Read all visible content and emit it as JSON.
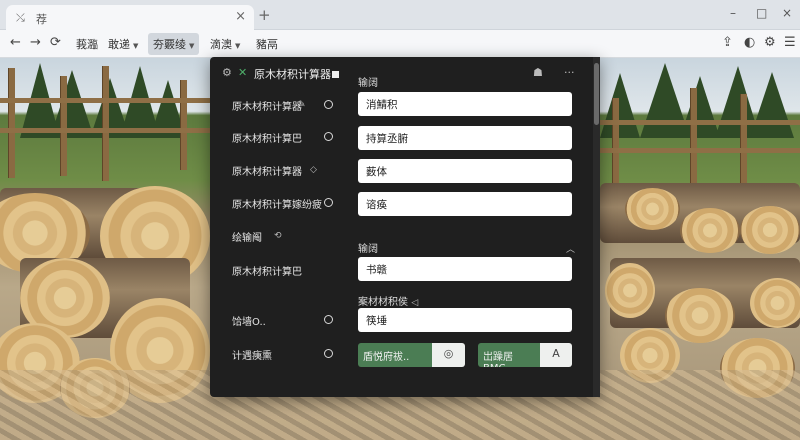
{
  "browser": {
    "tab_title": "荐",
    "tab_close": "×",
    "new_tab": "+",
    "window_controls": [
      "–",
      "□",
      "×"
    ],
    "nav": [
      "←",
      "→"
    ],
    "menus": [
      {
        "label": "莪瀶",
        "caret": false
      },
      {
        "label": "敢递",
        "caret": true
      },
      {
        "label": "夯覈绫",
        "caret": true,
        "active": true
      },
      {
        "label": "滴澳",
        "caret": true
      },
      {
        "label": "豬鬲",
        "caret": false
      }
    ],
    "right_icons": [
      "upload-icon",
      "half-circle-icon",
      "gear-icon",
      "menu-icon"
    ]
  },
  "panel": {
    "title": "原木材积计算器",
    "icons": [
      "gear-icon",
      "close-icon",
      "bug-icon",
      "more-icon"
    ],
    "list": [
      {
        "label": "原木材积计算器",
        "indicator": "✎"
      },
      {
        "label": "原木材积计算巴",
        "indicator": ""
      },
      {
        "label": "原木材积计算器",
        "indicator": "◇"
      },
      {
        "label": "原木材积计算嫁纷疲",
        "indicator": ""
      },
      {
        "label": "绘输阄",
        "indicator": "⟲"
      },
      {
        "label": "原木材积计算巴",
        "indicator": ""
      },
      {
        "label": "饸墙O..",
        "indicator": ""
      },
      {
        "label": "计遇痍熏",
        "indicator": ""
      }
    ],
    "section1_label": "输阔",
    "fields1": [
      "消鯖积",
      "持算丞腑",
      "薮体",
      "谘痪"
    ],
    "section2_label": "输阔",
    "field2": "书赣",
    "section3_label": "案材材积侯",
    "field3": "筷埵",
    "btn1_label": "盾悦府祓..",
    "btn2_label": "岀躁居BMC..",
    "btn1_icon": "eye-icon",
    "btn2_icon": "a-icon"
  }
}
